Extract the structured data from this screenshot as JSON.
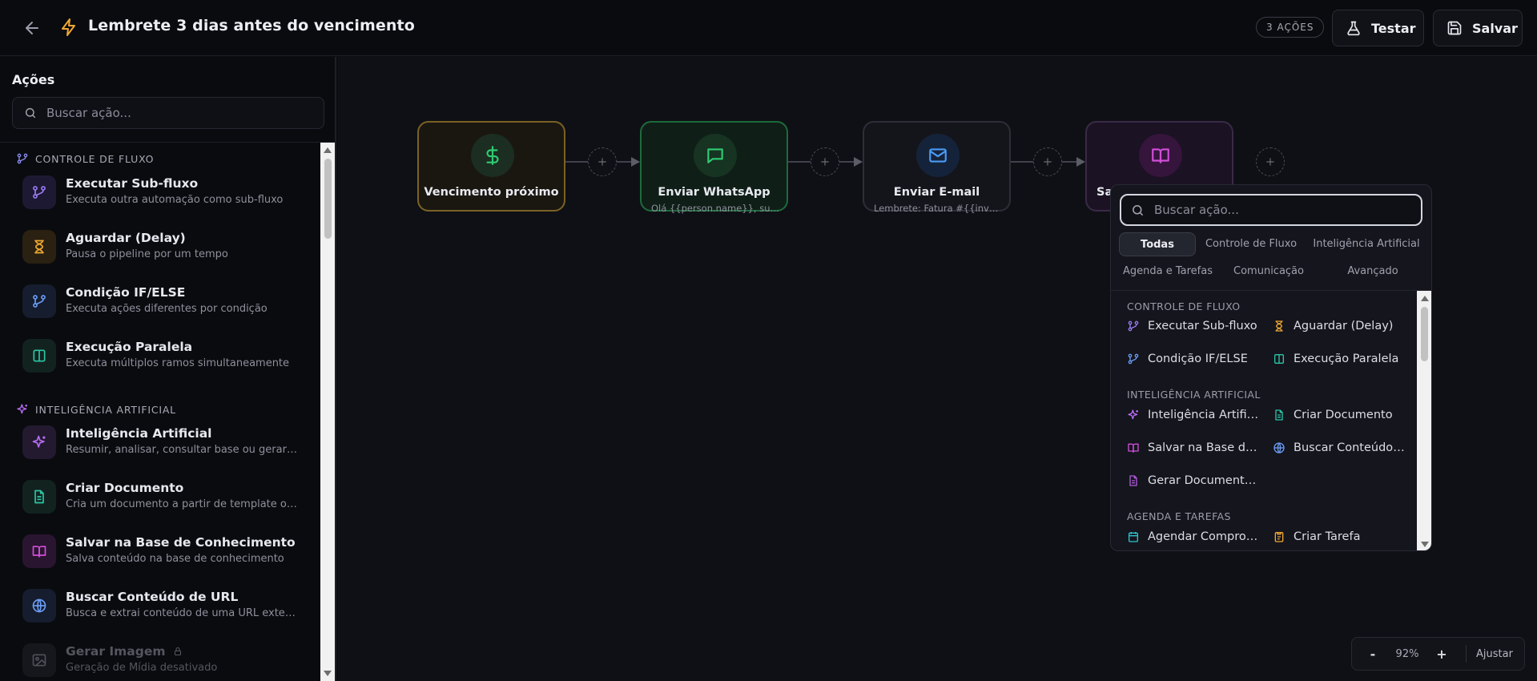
{
  "header": {
    "title": "Lembrete 3 dias antes do vencimento",
    "badge": "3 AÇÕES",
    "test_label": "Testar",
    "save_label": "Salvar"
  },
  "sidebar": {
    "title": "Ações",
    "search_placeholder": "Buscar ação...",
    "categories": {
      "flow": "CONTROLE DE FLUXO",
      "ai": "INTELIGÊNCIA ARTIFICIAL"
    },
    "items": [
      {
        "name": "Executar Sub-fluxo",
        "desc": "Executa outra automação como sub-fluxo"
      },
      {
        "name": "Aguardar (Delay)",
        "desc": "Pausa o pipeline por um tempo"
      },
      {
        "name": "Condição IF/ELSE",
        "desc": "Executa ações diferentes por condição"
      },
      {
        "name": "Execução Paralela",
        "desc": "Executa múltiplos ramos simultaneamente"
      },
      {
        "name": "Inteligência Artificial",
        "desc": "Resumir, analisar, consultar base ou gerar doc..."
      },
      {
        "name": "Criar Documento",
        "desc": "Cria um documento a partir de template ou co..."
      },
      {
        "name": "Salvar na Base de Conhecimento",
        "desc": "Salva conteúdo na base de conhecimento"
      },
      {
        "name": "Buscar Conteúdo de URL",
        "desc": "Busca e extrai conteúdo de uma URL externa"
      },
      {
        "name": "Gerar Imagem",
        "desc": "Geração de Mídia desativado"
      }
    ]
  },
  "nodes": [
    {
      "title": "Vencimento próximo",
      "subtitle": ""
    },
    {
      "title": "Enviar WhatsApp",
      "subtitle": "Olá {{person.name}}, sua f..."
    },
    {
      "title": "Enviar E-mail",
      "subtitle": "Lembrete: Fatura #{{invoi..."
    },
    {
      "title": "Sa",
      "subtitle": ""
    }
  ],
  "picker": {
    "search_placeholder": "Buscar ação...",
    "tabs": [
      "Todas",
      "Controle de Fluxo",
      "Inteligência Artificial",
      "Agenda e Tarefas",
      "Comunicação",
      "Avançado"
    ],
    "categories": {
      "flow": "CONTROLE DE FLUXO",
      "ai": "INTELIGÊNCIA ARTIFICIAL",
      "agenda": "AGENDA E TAREFAS"
    },
    "items": [
      "Executar Sub-fluxo",
      "Aguardar (Delay)",
      "Condição IF/ELSE",
      "Execução Paralela",
      "Inteligência Artificial",
      "Criar Documento",
      "Salvar na Base de Conhecimento",
      "Buscar Conteúdo de URL",
      "Gerar Documento PDF",
      "Agendar Compromisso",
      "Criar Tarefa"
    ]
  },
  "zoom": {
    "minus": "-",
    "value": "92%",
    "plus": "+",
    "fit": "Ajustar"
  },
  "colors": {
    "accent_yellow": "#f0a832",
    "accent_green": "#22c55e",
    "accent_blue": "#3b82f6",
    "accent_purple": "#c026d3",
    "accent_violet": "#8b5cf6",
    "accent_teal": "#14b8a6"
  }
}
